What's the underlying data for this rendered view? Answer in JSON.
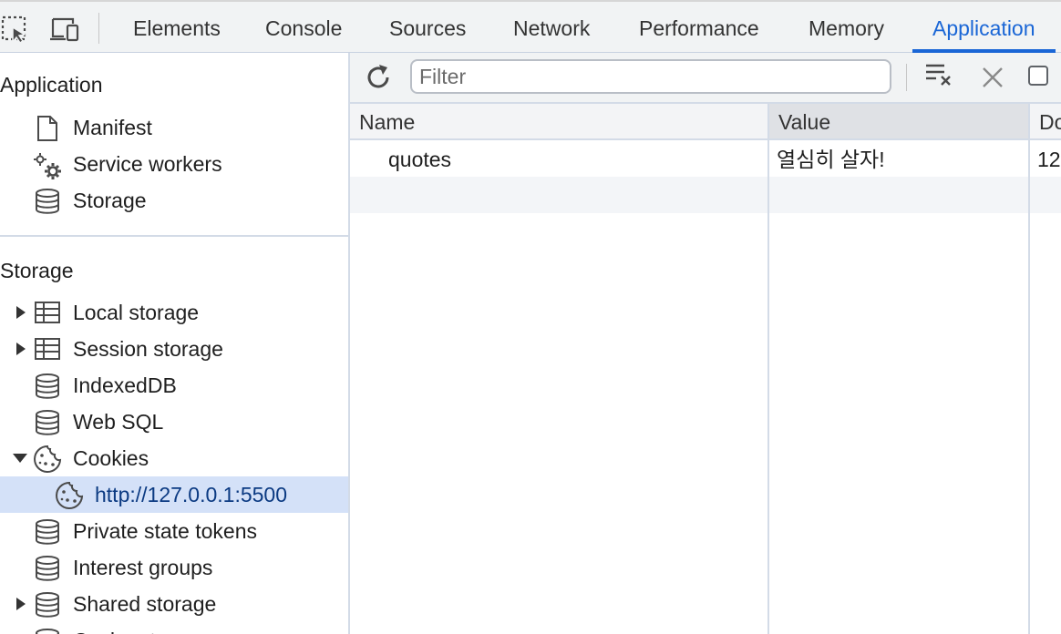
{
  "tabs": [
    {
      "label": "Elements"
    },
    {
      "label": "Console"
    },
    {
      "label": "Sources"
    },
    {
      "label": "Network"
    },
    {
      "label": "Performance"
    },
    {
      "label": "Memory"
    },
    {
      "label": "Application",
      "active": true
    }
  ],
  "sidebar": {
    "application_title": "Application",
    "application_items": [
      {
        "label": "Manifest",
        "icon": "file-icon"
      },
      {
        "label": "Service workers",
        "icon": "gears-icon"
      },
      {
        "label": "Storage",
        "icon": "database-icon"
      }
    ],
    "storage_title": "Storage",
    "storage_items": [
      {
        "label": "Local storage",
        "icon": "table-icon",
        "expander": "collapsed"
      },
      {
        "label": "Session storage",
        "icon": "table-icon",
        "expander": "collapsed"
      },
      {
        "label": "IndexedDB",
        "icon": "database-icon"
      },
      {
        "label": "Web SQL",
        "icon": "database-icon"
      },
      {
        "label": "Cookies",
        "icon": "cookie-icon",
        "expander": "expanded"
      },
      {
        "label": "http://127.0.0.1:5500",
        "icon": "cookie-icon",
        "selected": true
      },
      {
        "label": "Private state tokens",
        "icon": "database-icon"
      },
      {
        "label": "Interest groups",
        "icon": "database-icon"
      },
      {
        "label": "Shared storage",
        "icon": "database-icon",
        "expander": "collapsed"
      },
      {
        "label": "Cache storage",
        "icon": "database-icon"
      }
    ]
  },
  "toolbar": {
    "filter_placeholder": "Filter",
    "filter_value": ""
  },
  "table": {
    "columns": [
      "Name",
      "Value",
      "Do"
    ],
    "sorted_column": "Value",
    "rows": [
      {
        "name": "quotes",
        "value": "열심히 살자!",
        "domain": "12"
      }
    ]
  },
  "colors": {
    "accent": "#1a66d6",
    "selection": "#d4e1f8"
  }
}
